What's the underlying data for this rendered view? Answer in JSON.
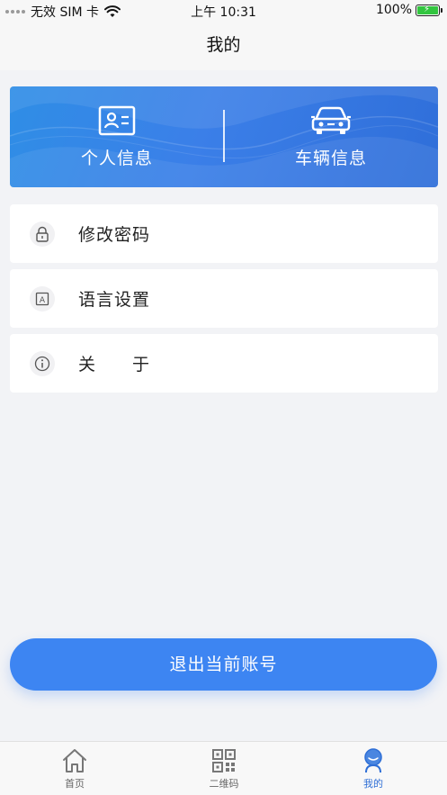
{
  "status_bar": {
    "carrier": "无效 SIM 卡",
    "time": "上午 10:31",
    "battery": "100%",
    "battery_level": 1.0
  },
  "nav": {
    "title": "我的"
  },
  "banner": {
    "personal_label": "个人信息",
    "vehicle_label": "车辆信息",
    "personal_icon": "id-card-icon",
    "vehicle_icon": "car-icon"
  },
  "menu": [
    {
      "label": "修改密码",
      "icon": "lock-icon"
    },
    {
      "label": "语言设置",
      "icon": "language-icon"
    },
    {
      "label": "关　　于",
      "icon": "info-icon"
    }
  ],
  "logout_label": "退出当前账号",
  "tabs": [
    {
      "label": "首页",
      "icon": "home-icon",
      "active": false
    },
    {
      "label": "二维码",
      "icon": "qr-code-icon",
      "active": false
    },
    {
      "label": "我的",
      "icon": "profile-icon",
      "active": true
    }
  ],
  "colors": {
    "accent": "#3d85f2",
    "banner_start": "#2f8ee6",
    "banner_end": "#2f6ed9",
    "active_tab": "#2f6fd6",
    "battery": "#32c53f"
  }
}
